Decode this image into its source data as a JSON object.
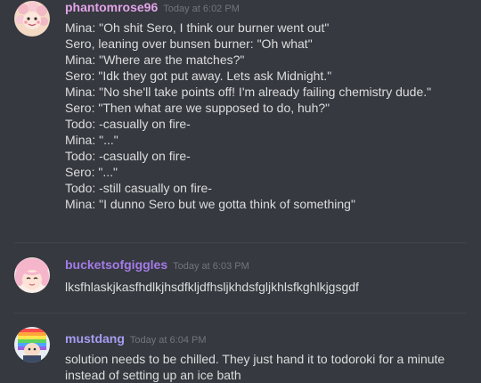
{
  "messages": [
    {
      "username": "phantomrose96",
      "username_color": "#e3a3e8",
      "timestamp": "Today at 6:02 PM",
      "avatar_icon": "flower-cartoon-avatar",
      "lines": [
        "Mina: \"Oh shit Sero, I think our burner went out\"",
        "Sero, leaning over bunsen burner: \"Oh what\"",
        "Mina: \"Where are the matches?\"",
        "Sero: \"Idk they got put away. Lets ask Midnight.\"",
        "Mina: \"No she'll take points off! I'm already failing chemistry dude.\"",
        "Sero: \"Then what are we supposed to do, huh?\"",
        "Todo: -casually on fire-",
        "Mina: \"...\"",
        "Todo: -casually on fire-",
        "Sero: \"...\"",
        "Todo: -still casually on fire-",
        "Mina: \"I dunno Sero but we gotta think of something\""
      ]
    },
    {
      "username": "bucketsofgiggles",
      "username_color": "#a47be8",
      "timestamp": "Today at 6:03 PM",
      "avatar_icon": "pink-haired-face-avatar",
      "lines": [
        "lksfhlaskjkasfhdlkjhsdfkljdfhsljkhdsfgljkhlsfkghlkjgsgdf"
      ]
    },
    {
      "username": "mustdang",
      "username_color": "#a79cf2",
      "timestamp": "Today at 6:04 PM",
      "avatar_icon": "rainbow-haired-character-avatar",
      "lines": [
        "solution needs to be chilled. They just hand it to todoroki for a minute instead of setting up an ice bath"
      ]
    }
  ]
}
